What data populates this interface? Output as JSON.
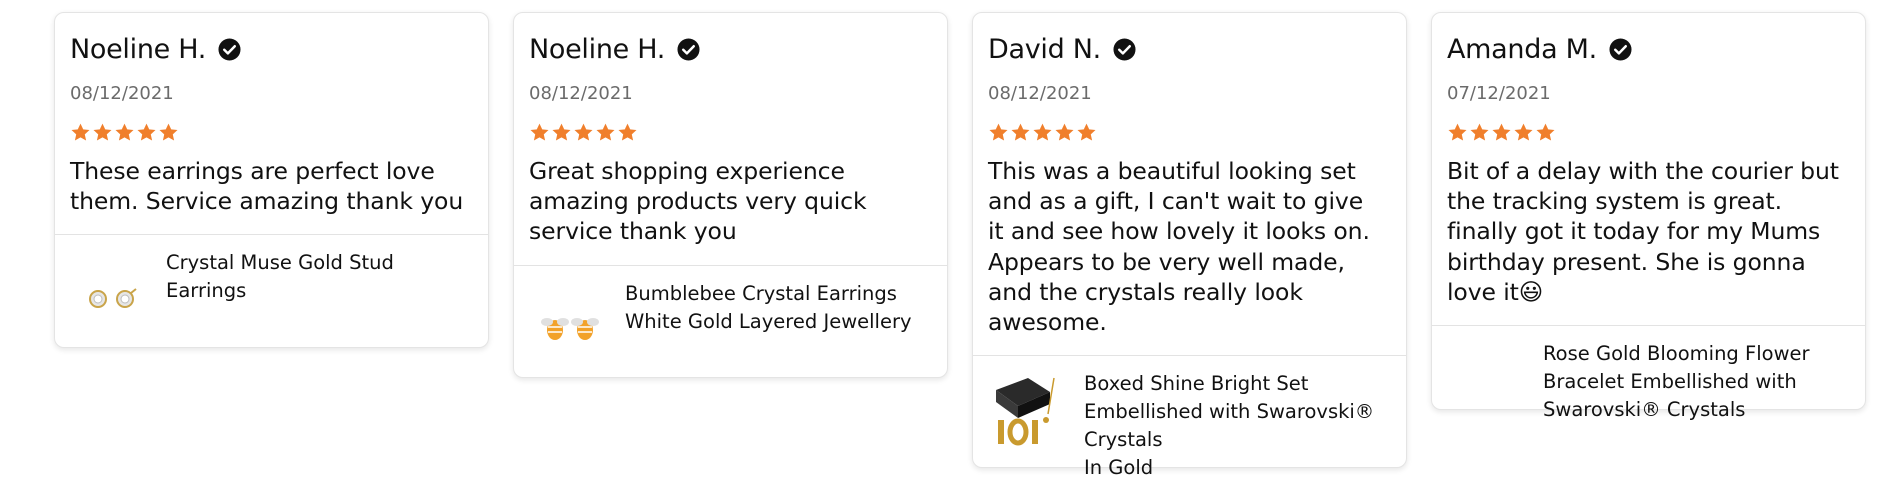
{
  "colors": {
    "star": "#f07f2c",
    "verified_badge": "#111111",
    "date_text": "#6b6b6b",
    "card_border": "#e4e4e4"
  },
  "icons": {
    "verified": "check-circle-icon",
    "star": "star-icon"
  },
  "reviews": [
    {
      "author": "Noeline H.",
      "date": "08/12/2021",
      "rating": 5,
      "body": "These earrings are perfect love them. Service amazing thank you",
      "product": {
        "name": "Crystal Muse Gold Stud Earrings"
      }
    },
    {
      "author": "Noeline H.",
      "date": "08/12/2021",
      "rating": 5,
      "body": "Great shopping experience amazing products very quick service thank you",
      "product": {
        "name": "Bumblebee Crystal Earrings White Gold Layered Jewellery"
      }
    },
    {
      "author": "David N.",
      "date": "08/12/2021",
      "rating": 5,
      "body": "This was a beautiful looking set and as a gift, I can't wait to give it and see how lovely it looks on.  Appears to be very well made, and the crystals really look awesome.",
      "product": {
        "name": "Boxed Shine Bright Set Embellished with Swarovski® Crystals\nIn Gold"
      }
    },
    {
      "author": "Amanda M.",
      "date": "07/12/2021",
      "rating": 5,
      "body": " Bit of a delay with the courier but the tracking system is great. finally got it today for my Mums birthday present. She is gonna love it😃",
      "product": {
        "name": "Rose Gold Blooming Flower Bracelet Embellished with Swarovski® Crystals"
      }
    }
  ]
}
